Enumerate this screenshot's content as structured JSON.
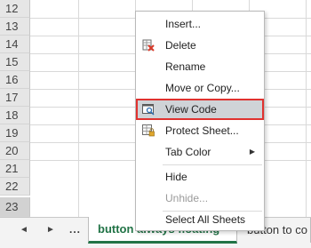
{
  "row_headers": [
    "12",
    "13",
    "14",
    "15",
    "16",
    "17",
    "18",
    "19",
    "20",
    "21",
    "22",
    "23"
  ],
  "tabs": {
    "prev_arrow": "◄",
    "next_arrow": "►",
    "ellipsis": "...",
    "active_label": "button always floating",
    "other_label": "button to co"
  },
  "menu": {
    "insert": "Insert...",
    "delete": "Delete",
    "rename": "Rename",
    "move_copy": "Move or Copy...",
    "view_code": "View Code",
    "protect_sheet": "Protect Sheet...",
    "tab_color": "Tab Color",
    "hide": "Hide",
    "unhide": "Unhide...",
    "select_all": "Select All Sheets",
    "submenu_arrow": "▶"
  },
  "colors": {
    "accent_green": "#217346",
    "highlight_border": "#e0322f",
    "delete_icon_red": "#d83b2b"
  }
}
